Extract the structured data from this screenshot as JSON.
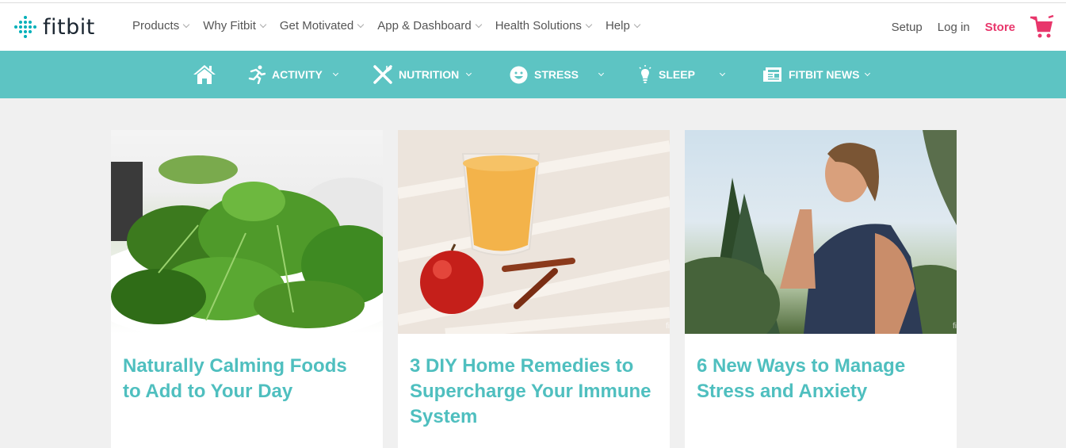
{
  "brand": {
    "name": "fitbit",
    "accent": "#00b0b9",
    "teal": "#5dc4c3",
    "store_color": "#e8366b"
  },
  "main_nav": [
    {
      "label": "Products"
    },
    {
      "label": "Why Fitbit"
    },
    {
      "label": "Get Motivated"
    },
    {
      "label": "App & Dashboard"
    },
    {
      "label": "Health Solutions"
    },
    {
      "label": "Help"
    }
  ],
  "right_nav": {
    "setup": "Setup",
    "login": "Log in",
    "store": "Store",
    "cart_icon": "shopping-cart-icon"
  },
  "sub_nav": [
    {
      "label": "",
      "icon": "home-icon"
    },
    {
      "label": "ACTIVITY",
      "icon": "running-icon"
    },
    {
      "label": "NUTRITION",
      "icon": "utensils-icon"
    },
    {
      "label": "STRESS",
      "icon": "smile-icon"
    },
    {
      "label": "SLEEP",
      "icon": "lightbulb-icon"
    },
    {
      "label": "FITBIT NEWS",
      "icon": "newspaper-icon"
    }
  ],
  "cards": [
    {
      "title": "Naturally Calming Foods to Add to Your Day",
      "image": "spinach leaves in bowl"
    },
    {
      "title": "3 DIY Home Remedies to Supercharge Your Immune System",
      "image": "orange smoothie with apple and cinnamon"
    },
    {
      "title": "6 New Ways to Manage Stress and Anxiety",
      "image": "woman doing yoga outdoors",
      "watermark": "fi"
    }
  ],
  "watermark": "fi"
}
